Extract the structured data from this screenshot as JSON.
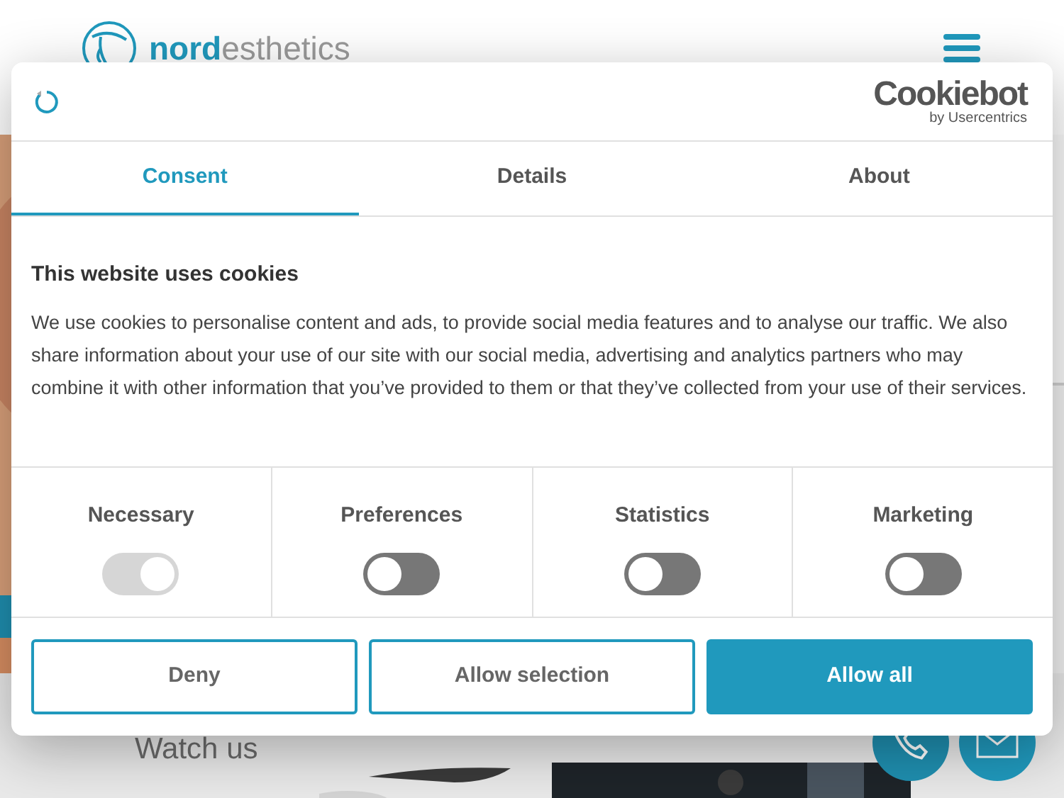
{
  "site": {
    "logo_bold": "nord",
    "logo_light": "esthetics",
    "section_title": "Watch us"
  },
  "dialog": {
    "brand": "Cookiebot",
    "brand_sub": "by Usercentrics",
    "tabs": [
      {
        "label": "Consent",
        "selected": true
      },
      {
        "label": "Details",
        "selected": false
      },
      {
        "label": "About",
        "selected": false
      }
    ],
    "title": "This website uses cookies",
    "body": "We use cookies to personalise content and ads, to provide social media features and to analyse our traffic. We also share information about your use of our site with our social media, advertising and analytics partners who may combine it with other information that you’ve provided to them or that they’ve collected from your use of their services.",
    "categories": [
      {
        "label": "Necessary",
        "checked": true,
        "disabled": true
      },
      {
        "label": "Preferences",
        "checked": false,
        "disabled": false
      },
      {
        "label": "Statistics",
        "checked": false,
        "disabled": false
      },
      {
        "label": "Marketing",
        "checked": false,
        "disabled": false
      }
    ],
    "buttons": [
      {
        "label": "Deny",
        "kind": "outline"
      },
      {
        "label": "Allow selection",
        "kind": "outline"
      },
      {
        "label": "Allow all",
        "kind": "filled"
      }
    ]
  }
}
